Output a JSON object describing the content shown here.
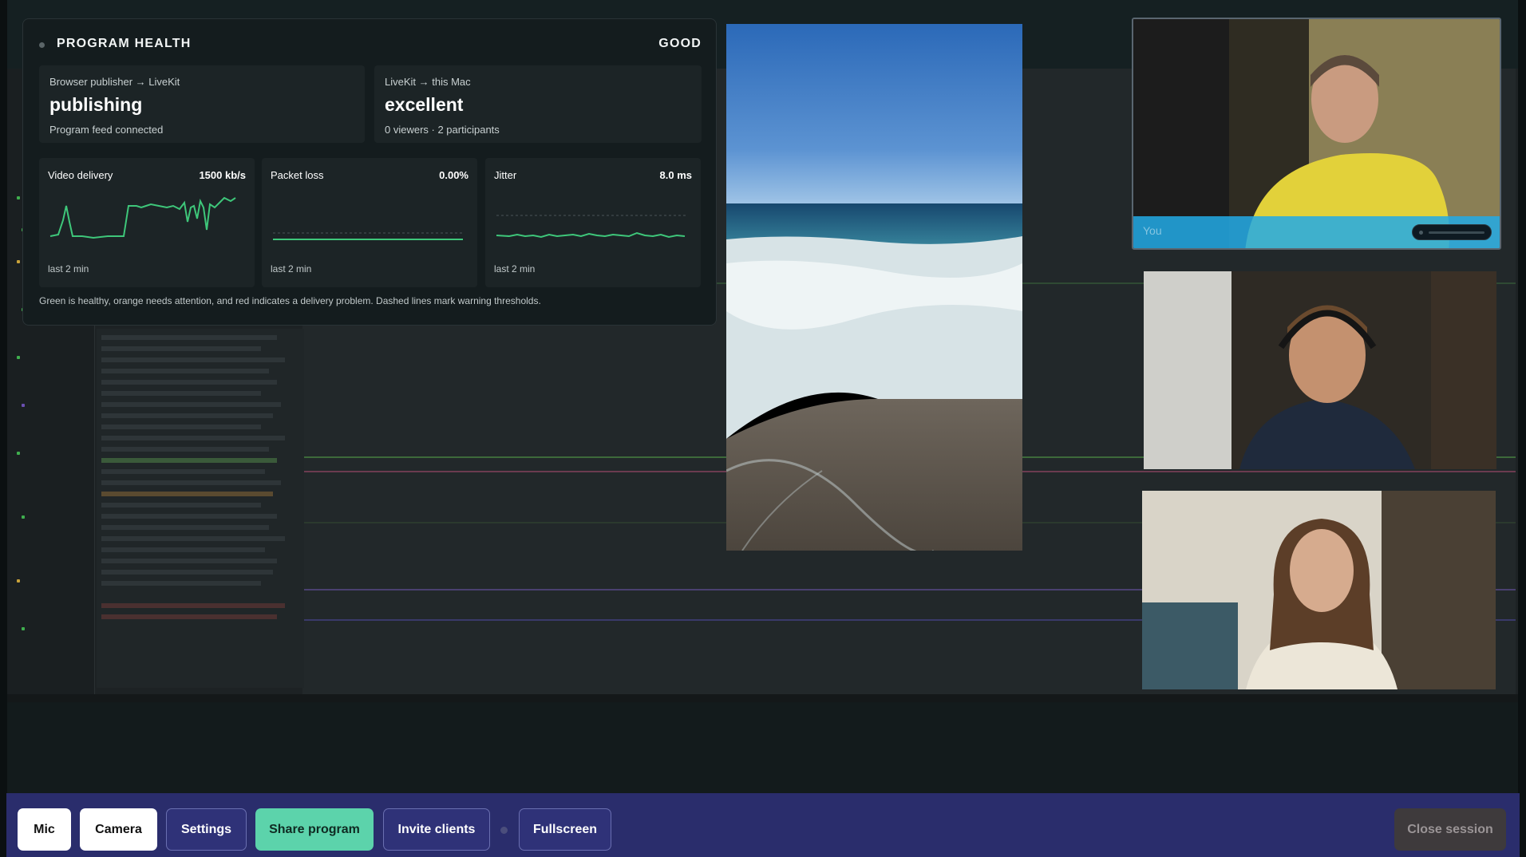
{
  "health": {
    "title": "PROGRAM HEALTH",
    "status": "GOOD",
    "publisher": {
      "route": "Browser publisher → LiveKit",
      "state": "publishing",
      "detail": "Program feed connected"
    },
    "receiver": {
      "route": "LiveKit → this Mac",
      "state": "excellent",
      "detail": "0 viewers · 2 participants"
    },
    "metrics": [
      {
        "label": "Video delivery",
        "value": "1500 kb/s",
        "window": "last 2 min",
        "status": "healthy"
      },
      {
        "label": "Packet loss",
        "value": "0.00%",
        "window": "last 2 min",
        "status": "healthy"
      },
      {
        "label": "Jitter",
        "value": "8.0 ms",
        "window": "last 2 min",
        "status": "healthy"
      }
    ],
    "note": "Green is healthy, orange needs attention, and red indicates a delivery problem. Dashed lines mark warning thresholds."
  },
  "tiles": {
    "you_label": "You"
  },
  "toolbar": {
    "mic": "Mic",
    "camera": "Camera",
    "settings": "Settings",
    "share": "Share program",
    "invite": "Invite clients",
    "fullscreen": "Fullscreen",
    "close": "Close session"
  },
  "colors": {
    "healthy": "#3ec77a",
    "toolbar_bg": "#2a2d6c",
    "share_accent": "#5cd3ab",
    "you_bar": "#22aae6"
  }
}
